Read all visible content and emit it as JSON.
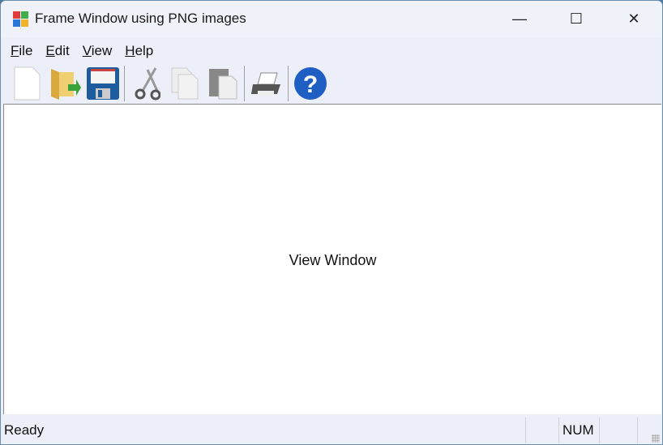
{
  "window": {
    "title": "Frame Window using PNG images",
    "controls": {
      "minimize": "—",
      "maximize": "☐",
      "close": "✕"
    }
  },
  "menu": [
    {
      "label": "File",
      "accel": "F",
      "rest": "ile"
    },
    {
      "label": "Edit",
      "accel": "E",
      "rest": "dit"
    },
    {
      "label": "View",
      "accel": "V",
      "rest": "iew"
    },
    {
      "label": "Help",
      "accel": "H",
      "rest": "elp"
    }
  ],
  "toolbar": [
    "new-icon",
    "open-icon",
    "save-icon",
    "cut-icon",
    "copy-icon",
    "paste-icon",
    "print-icon",
    "help-icon"
  ],
  "view": {
    "text": "View Window"
  },
  "status": {
    "text": "Ready",
    "num": "NUM"
  },
  "colors": {
    "chrome": "#eceef8",
    "view": "#ffffff",
    "help": "#1f5fc4",
    "save": "#1e5c9e"
  }
}
